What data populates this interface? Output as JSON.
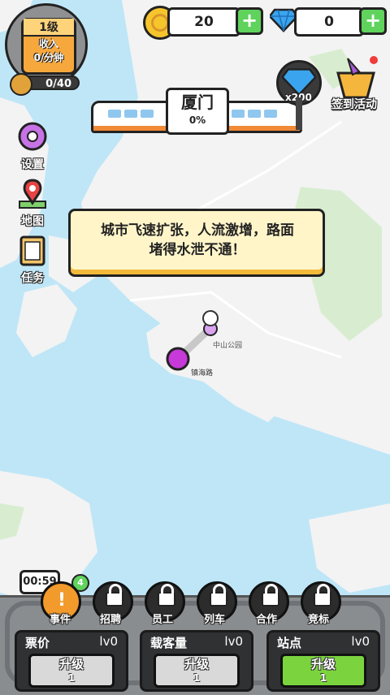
{
  "currency": {
    "coins": "20",
    "gems": "0"
  },
  "level": {
    "title": "1级",
    "income_label": "收入",
    "income_value": "0/分钟",
    "progress": "0/40"
  },
  "city": {
    "name": "厦门",
    "progress": "0%"
  },
  "gem_reward": "x200",
  "checkin_label": "签到活动",
  "side_menu": [
    {
      "label": "设置",
      "icon": "gear-icon"
    },
    {
      "label": "地图",
      "icon": "map-pin-icon"
    },
    {
      "label": "任务",
      "icon": "clipboard-icon"
    }
  ],
  "popup": {
    "line1": "城市飞速扩张，人流激增，路面",
    "line2": "堵得水泄不通！"
  },
  "map": {
    "station_1": "中山公园",
    "station_2": "镇海路"
  },
  "event": {
    "timer": "00:59",
    "badge": "4",
    "label": "事件"
  },
  "bottom_buttons": [
    {
      "label": "招聘",
      "icon": "recruit-icon"
    },
    {
      "label": "员工",
      "icon": "staff-icon"
    },
    {
      "label": "列车",
      "icon": "train-icon"
    },
    {
      "label": "合作",
      "icon": "partner-icon"
    },
    {
      "label": "竞标",
      "icon": "bid-icon"
    }
  ],
  "upgrades": [
    {
      "title": "票价",
      "level": "lv0",
      "button": "升级",
      "cost": "1"
    },
    {
      "title": "载客量",
      "level": "lv0",
      "button": "升级",
      "cost": "1"
    },
    {
      "title": "站点",
      "level": "lv0",
      "button": "升级",
      "cost": "1"
    }
  ],
  "colors": {
    "sea": "#bfe6f7",
    "land": "#f3f3f3",
    "park": "#d8edd0",
    "accent_orange": "#f7a83d",
    "station": "#c73ad9",
    "green_button": "#7bd43e"
  }
}
